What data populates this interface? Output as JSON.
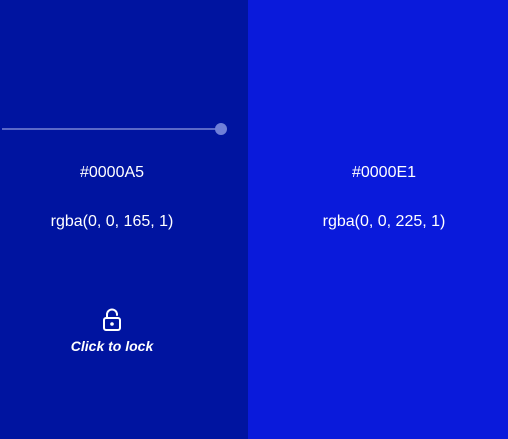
{
  "panels": [
    {
      "name": "left-swatch",
      "bg_color": "#0014A0",
      "hex": "#0000A5",
      "rgba": "rgba(0, 0, 165, 1)",
      "lock_label": "Click to lock",
      "lock_icon": "unlocked-padlock-icon",
      "slider_level": 1.0
    },
    {
      "name": "right-swatch",
      "bg_color": "#0A1ADB",
      "hex": "#0000E1",
      "rgba": "rgba(0, 0, 225, 1)"
    }
  ]
}
